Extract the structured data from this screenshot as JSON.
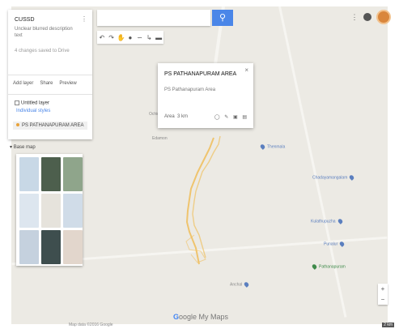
{
  "app": {
    "title": "CUSSD",
    "description": "Unclear blurred description text",
    "meta": "4 changes saved to Drive"
  },
  "panel": {
    "actions": [
      "Add layer",
      "Share",
      "Preview"
    ],
    "layer_title": "Untitled layer",
    "layer_link": "Individual styles",
    "layer_item": "PS PATHANAPURAM AREA"
  },
  "basemap": {
    "label": "Base map",
    "tiles": [
      "#c8d8e6",
      "#4d5f4d",
      "#8fa58b",
      "#dde6ef",
      "#e6e3dc",
      "#d0dce8",
      "#c5d1de",
      "#3e4e4e",
      "#e2d6cc"
    ]
  },
  "popup": {
    "title": "PS PATHANAPURAM AREA",
    "description": "PS Pathanapuram Area",
    "area": "Area",
    "measure": "3 km"
  },
  "map_labels": {
    "label_1": "Ochira",
    "label_2": "Edamon",
    "label_3": "Thenmala",
    "label_4": "Chadayamangalam",
    "label_5": "Kulathupuzha",
    "label_6": "Punalur",
    "label_7": "Pathanapuram",
    "label_8": "Anchal"
  },
  "brand": {
    "logo_g": "G",
    "logo_rest": "oogle My Maps"
  },
  "footer": {
    "attribution": "Map data ©2016 Google",
    "scale": "2 km"
  },
  "colors": {
    "accent": "#4a86e8",
    "route": "#f0c060",
    "map_bg": "#eceae4"
  }
}
